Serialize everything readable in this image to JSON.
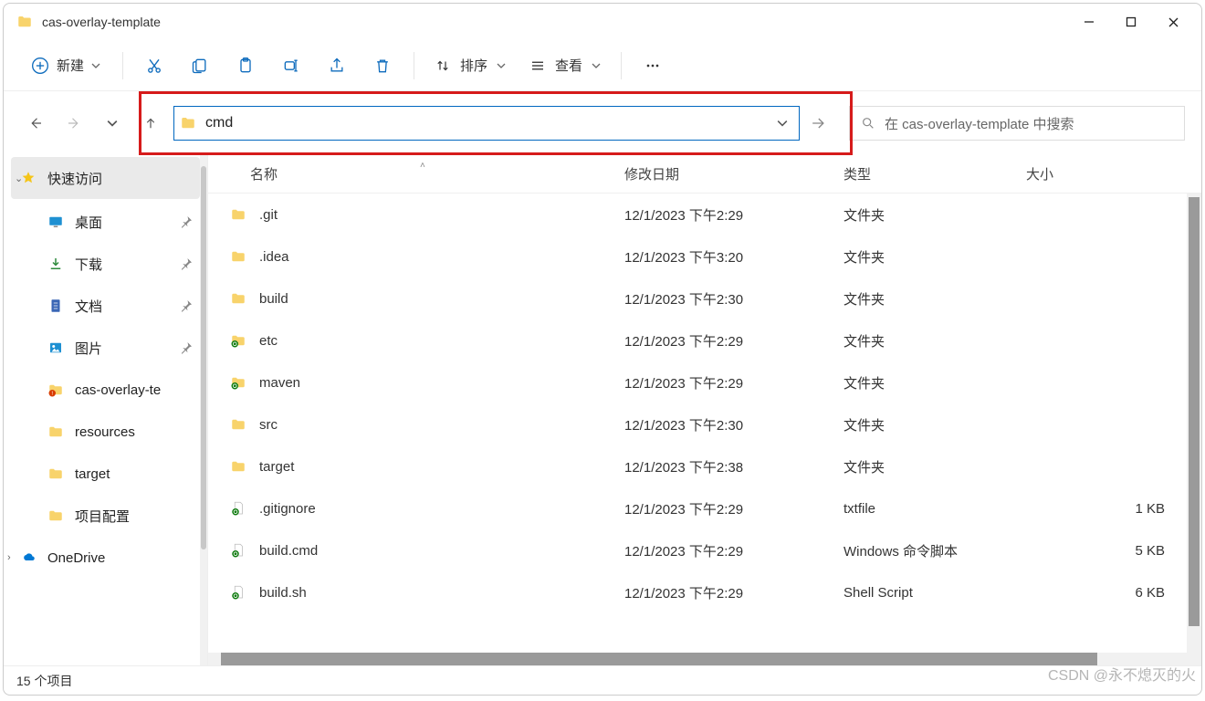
{
  "window": {
    "title": "cas-overlay-template"
  },
  "toolbar": {
    "new_label": "新建",
    "sort_label": "排序",
    "view_label": "查看"
  },
  "address": {
    "value": "cmd"
  },
  "search": {
    "placeholder": "在 cas-overlay-template 中搜索"
  },
  "sidebar": {
    "items": [
      {
        "label": "快速访问",
        "icon": "star",
        "chev": true,
        "selected": true
      },
      {
        "label": "桌面",
        "icon": "desktop",
        "pin": true,
        "indent": true
      },
      {
        "label": "下载",
        "icon": "download",
        "pin": true,
        "indent": true
      },
      {
        "label": "文档",
        "icon": "doc",
        "pin": true,
        "indent": true
      },
      {
        "label": "图片",
        "icon": "pic",
        "pin": true,
        "indent": true
      },
      {
        "label": "cas-overlay-te",
        "icon": "folder-alert",
        "indent": true
      },
      {
        "label": "resources",
        "icon": "folder",
        "indent": true
      },
      {
        "label": "target",
        "icon": "folder",
        "indent": true
      },
      {
        "label": "项目配置",
        "icon": "folder",
        "indent": true
      },
      {
        "label": "OneDrive",
        "icon": "onedrive",
        "chev_r": true
      }
    ]
  },
  "columns": {
    "name": "名称",
    "date": "修改日期",
    "type": "类型",
    "size": "大小"
  },
  "files": [
    {
      "name": ".git",
      "date": "12/1/2023 下午2:29",
      "type": "文件夹",
      "size": "",
      "icon": "folder"
    },
    {
      "name": ".idea",
      "date": "12/1/2023 下午3:20",
      "type": "文件夹",
      "size": "",
      "icon": "folder"
    },
    {
      "name": "build",
      "date": "12/1/2023 下午2:30",
      "type": "文件夹",
      "size": "",
      "icon": "folder"
    },
    {
      "name": "etc",
      "date": "12/1/2023 下午2:29",
      "type": "文件夹",
      "size": "",
      "icon": "folder-sync"
    },
    {
      "name": "maven",
      "date": "12/1/2023 下午2:29",
      "type": "文件夹",
      "size": "",
      "icon": "folder-sync"
    },
    {
      "name": "src",
      "date": "12/1/2023 下午2:30",
      "type": "文件夹",
      "size": "",
      "icon": "folder"
    },
    {
      "name": "target",
      "date": "12/1/2023 下午2:38",
      "type": "文件夹",
      "size": "",
      "icon": "folder"
    },
    {
      "name": ".gitignore",
      "date": "12/1/2023 下午2:29",
      "type": "txtfile",
      "size": "1 KB",
      "icon": "file-sync"
    },
    {
      "name": "build.cmd",
      "date": "12/1/2023 下午2:29",
      "type": "Windows 命令脚本",
      "size": "5 KB",
      "icon": "file-sync"
    },
    {
      "name": "build.sh",
      "date": "12/1/2023 下午2:29",
      "type": "Shell Script",
      "size": "6 KB",
      "icon": "file-sync"
    }
  ],
  "status": {
    "text": "15 个项目"
  },
  "watermark": "CSDN @永不熄灭的⽕"
}
